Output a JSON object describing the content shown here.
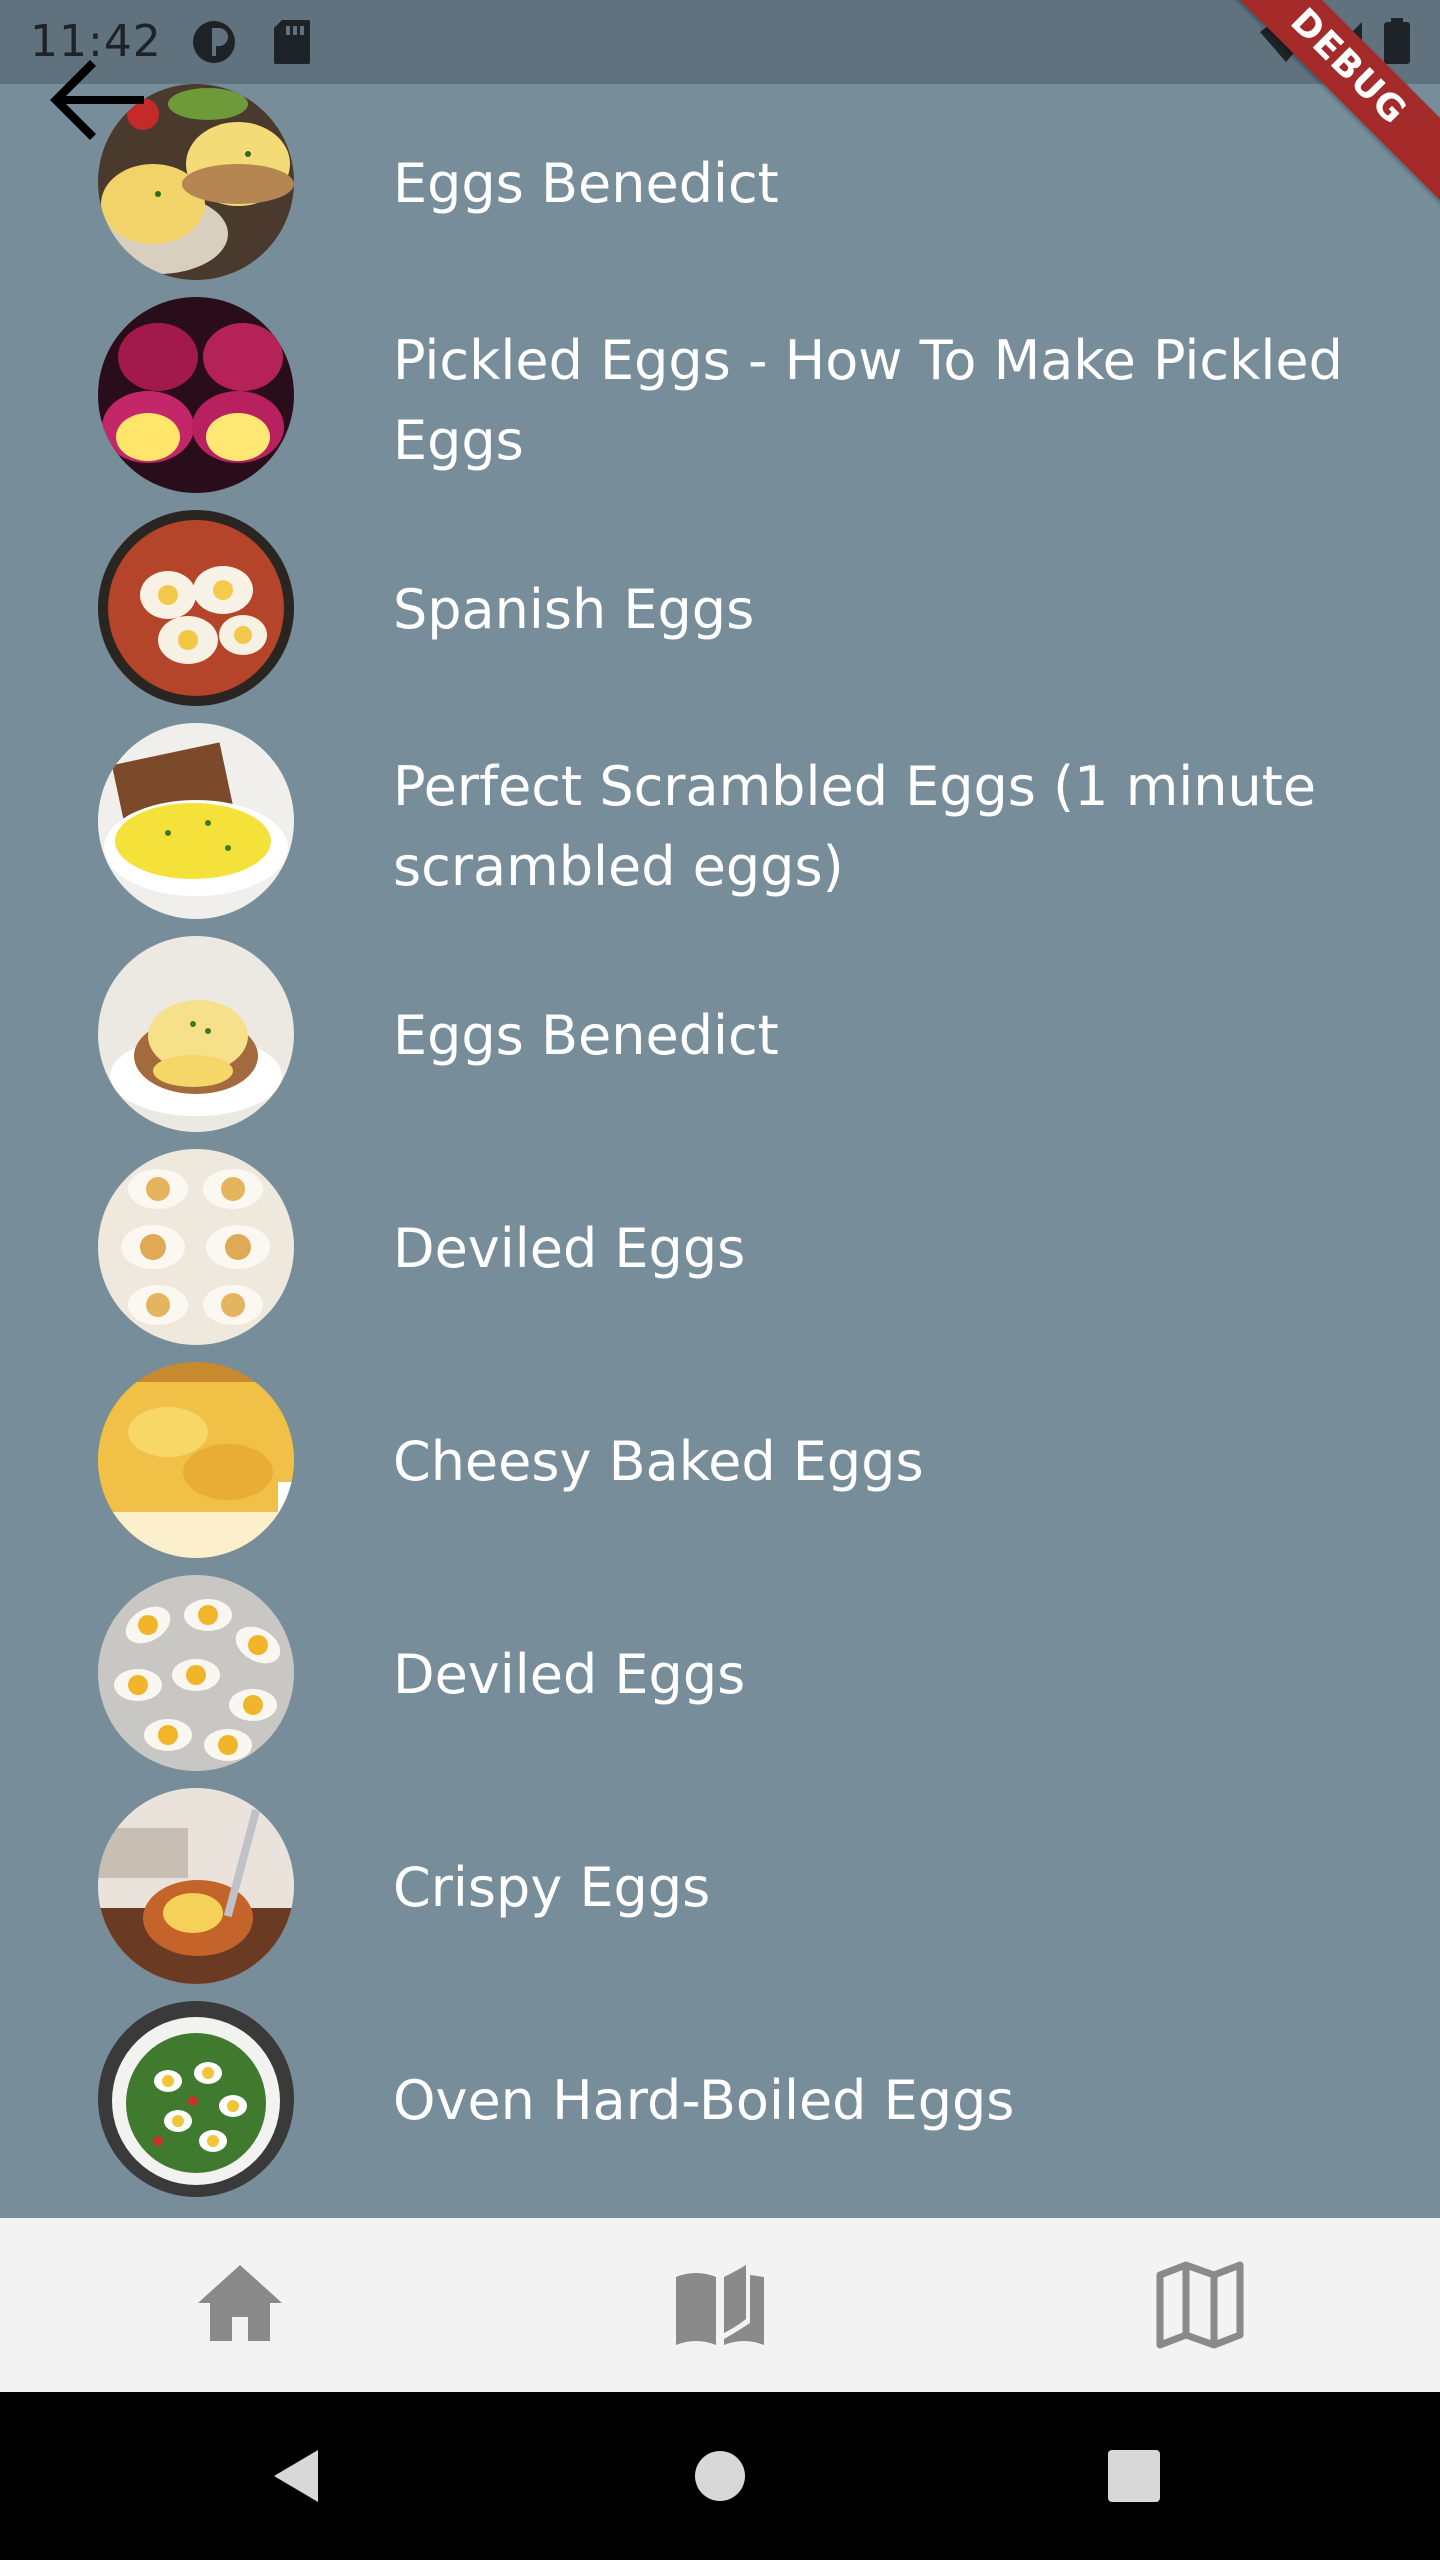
{
  "status_bar": {
    "time": "11:42",
    "debug_label": "DEBUG"
  },
  "recipes": [
    {
      "title": "Eggs Benedict"
    },
    {
      "title": "Pickled Eggs - How To Make Pickled Eggs"
    },
    {
      "title": "Spanish Eggs"
    },
    {
      "title": "Perfect Scrambled Eggs (1 minute scrambled eggs)"
    },
    {
      "title": "Eggs Benedict"
    },
    {
      "title": "Deviled Eggs"
    },
    {
      "title": "Cheesy Baked Eggs"
    },
    {
      "title": "Deviled Eggs"
    },
    {
      "title": "Crispy Eggs"
    },
    {
      "title": "Oven Hard-Boiled Eggs"
    }
  ],
  "bottom_nav": {
    "items": [
      {
        "icon": "home-icon"
      },
      {
        "icon": "open-book-icon"
      },
      {
        "icon": "map-icon"
      }
    ]
  },
  "colors": {
    "background": "#778d9a",
    "status_bar": "#5f727e",
    "nav_bar": "#f3f3f4",
    "nav_icon": "#8a8a8a",
    "debug_banner": "#a52a2a"
  }
}
